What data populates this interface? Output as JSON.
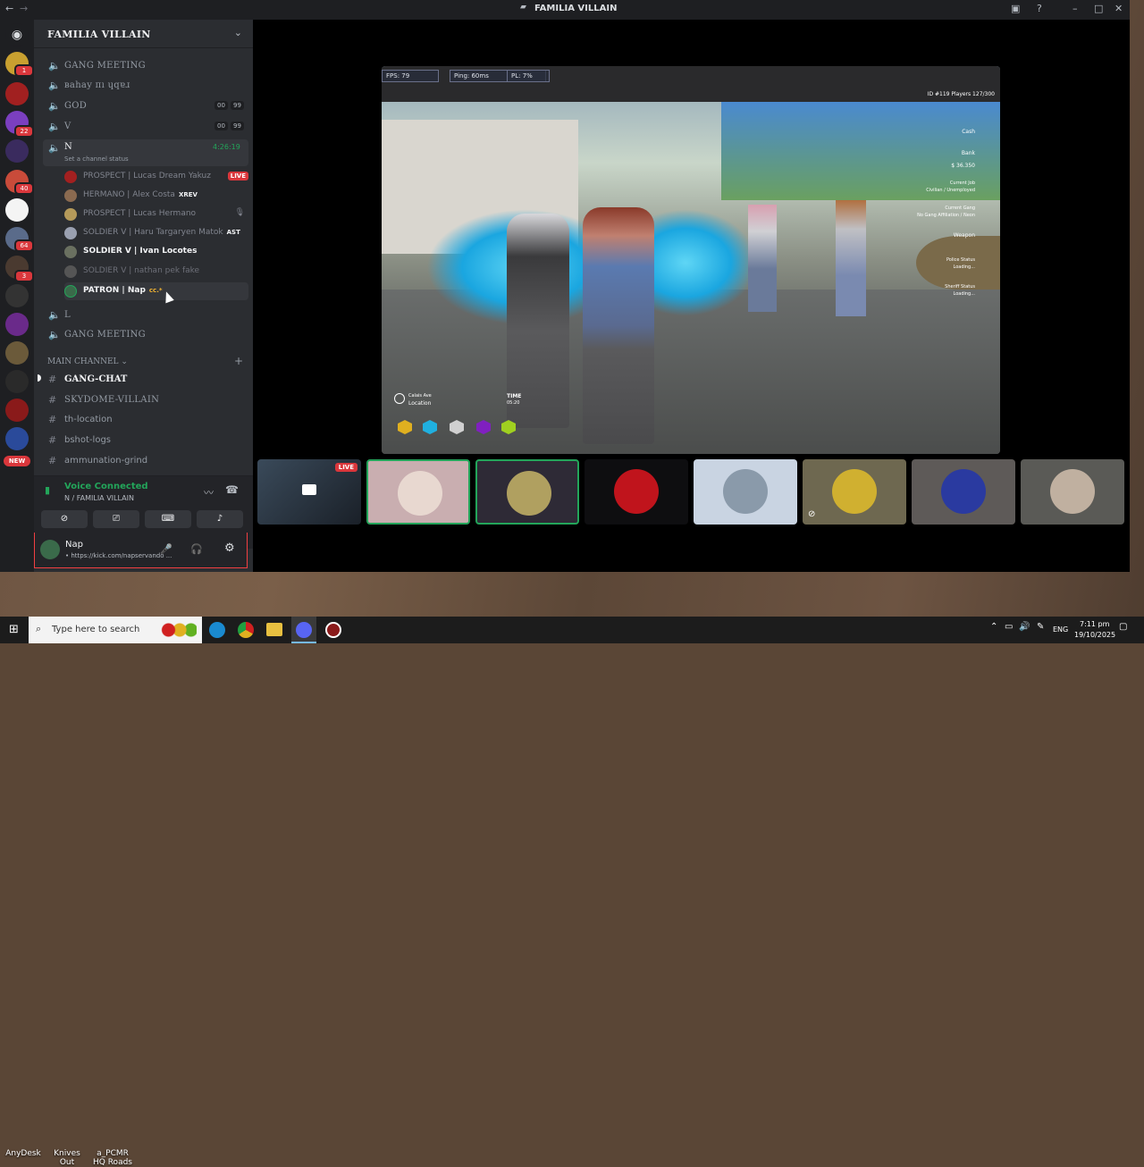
{
  "window": {
    "title": "FAMILIA VILLAIN"
  },
  "guild": {
    "name": "FAMILIA VILLAIN"
  },
  "channels_top": [
    {
      "name": "GANG MEETING",
      "type": "voice"
    },
    {
      "name": "ваhаy пı ɥqɐɹ",
      "type": "voice"
    },
    {
      "name": "GOD",
      "type": "voice",
      "count_left": "00",
      "count_right": "99"
    },
    {
      "name": "V",
      "type": "voice",
      "count_left": "00",
      "count_right": "99"
    }
  ],
  "active_voice": {
    "name": "N",
    "status_placeholder": "Set a channel status",
    "timer": "4:26:19",
    "members": [
      {
        "name": "PROSPECT | Lucas Dream Yakuz",
        "live": "LIVE",
        "tag": ""
      },
      {
        "name": "HERMANO | Alex Costa",
        "tag": "XREV"
      },
      {
        "name": "PROSPECT | Lucas Hermano",
        "tag": ""
      },
      {
        "name": "SOLDIER V | Haru Targaryen Matok",
        "tag": "AST"
      },
      {
        "name": "SOLDIER V | Ivan Locotes",
        "tag": ""
      },
      {
        "name": "SOLDIER V | nathan pek fake",
        "tag": ""
      },
      {
        "name": "PATRON | Nap",
        "tag": "cc.*"
      }
    ]
  },
  "channels_mid": [
    {
      "name": "L",
      "type": "voice"
    },
    {
      "name": "GANG MEETING",
      "type": "voice"
    }
  ],
  "category": {
    "name": "MAIN CHANNEL"
  },
  "text_channels": [
    {
      "name": "GANG-CHAT"
    },
    {
      "name": "SKYDOME-VILLAIN"
    },
    {
      "name": "th-location"
    },
    {
      "name": "bshot-logs"
    },
    {
      "name": "ammunation-grind"
    }
  ],
  "voice_panel": {
    "title": "Voice Connected",
    "subtitle": "N / FAMILIA VILLAIN"
  },
  "user_panel": {
    "name": "Nap",
    "status": "• https://kick.com/napservando ..."
  },
  "server_badges": [
    "1",
    "22",
    "40",
    "64",
    "3",
    "NEW"
  ],
  "stream": {
    "hud_fps": "FPS: 79",
    "hud_ping": "Ping: 60ms",
    "hud_pl": "PL: 7%",
    "hud_top_right": "ID #119  Players 127/300",
    "hud_cash": "Cash",
    "hud_bank": "Bank",
    "hud_bank_value": "$ 36.350",
    "hud_job_label": "Current Job",
    "hud_job_value": "Civilian / Unemployed",
    "hud_gang_label": "Current Gang",
    "hud_gang_value": "No Gang Affiliation / Neon",
    "hud_weapon": "Weapon",
    "hud_police_label": "Police Status",
    "hud_police_value": "Loading...",
    "hud_sheriff_label": "Sheriff Status",
    "hud_sheriff_value": "Loading...",
    "hud_location_street": "Calais Ave",
    "hud_location_label": "Location",
    "hud_time_label": "TIME",
    "hud_time_value": "05:20"
  },
  "tiles_live_label": "LIVE",
  "desktop_icons": [
    "AnyDesk",
    "Knives Out",
    "a_PCMR HQ Roads"
  ],
  "taskbar": {
    "search_placeholder": "Type here to search",
    "lang": "ENG",
    "time": "7:11 pm",
    "date": "19/10/2025"
  },
  "colors": {
    "accent_green": "#23a55a",
    "live_red": "#da373c",
    "sidebar": "#2b2d31",
    "rail": "#1e1f22"
  }
}
